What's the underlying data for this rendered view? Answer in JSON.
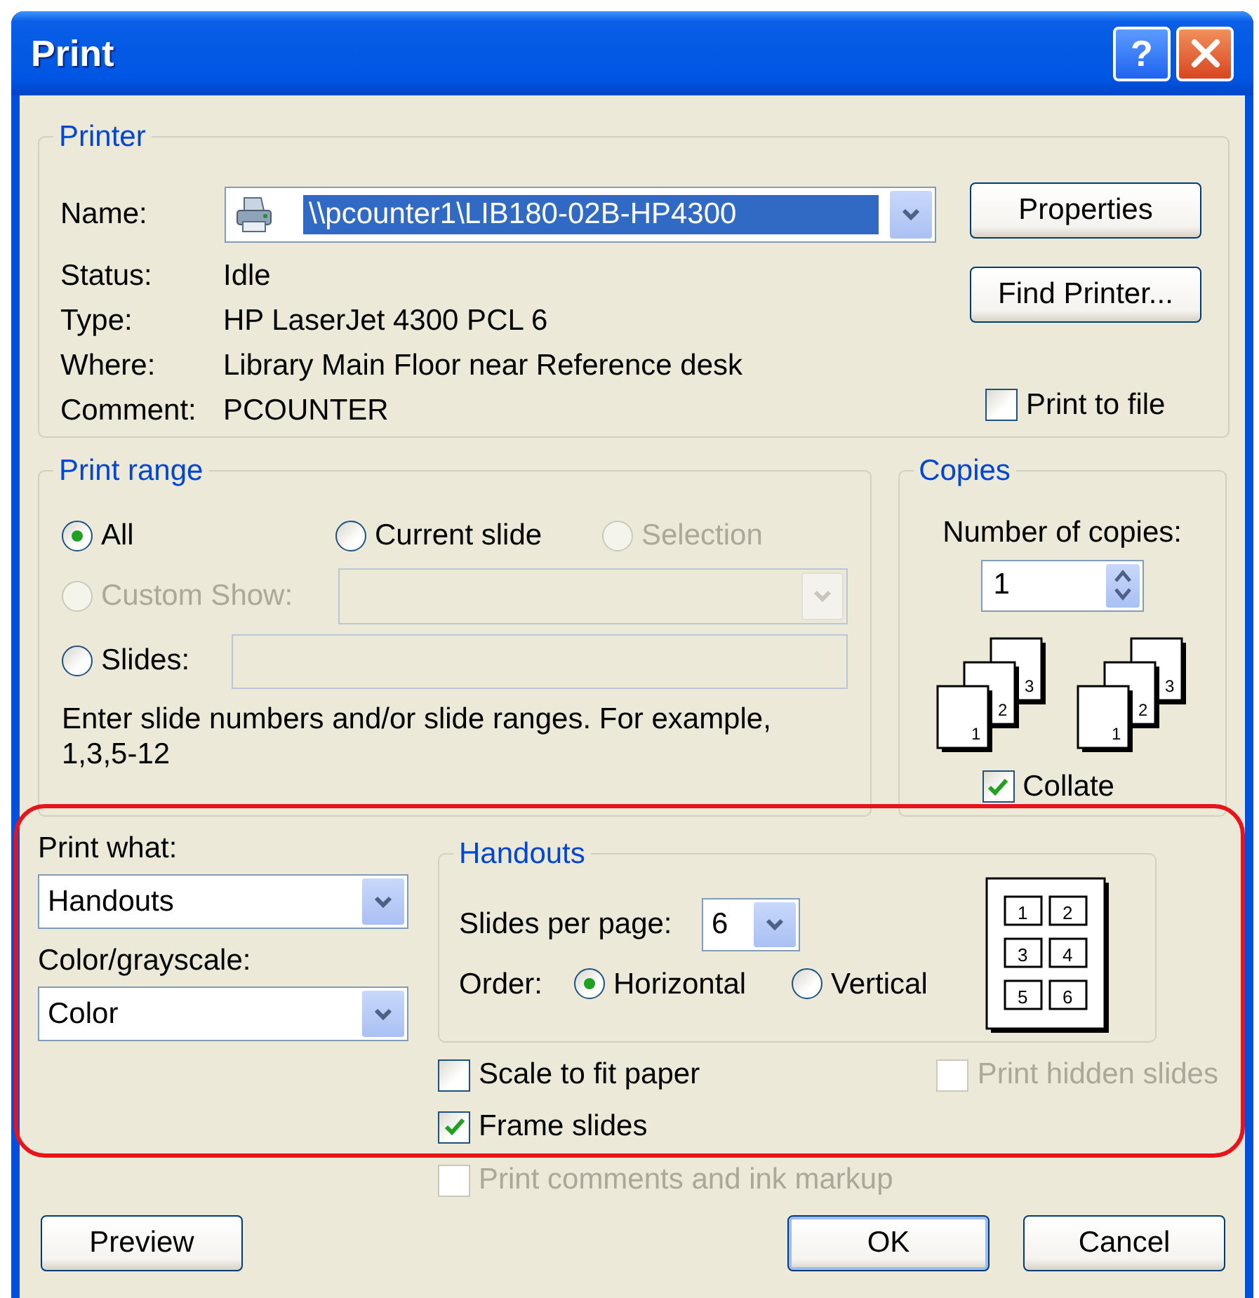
{
  "window": {
    "title": "Print",
    "help_button": "?"
  },
  "printer": {
    "legend": "Printer",
    "name_label": "Name:",
    "name_value": "\\\\pcounter1\\LIB180-02B-HP4300",
    "details": [
      {
        "label": "Status:",
        "value": "Idle"
      },
      {
        "label": "Type:",
        "value": "HP LaserJet 4300 PCL 6"
      },
      {
        "label": "Where:",
        "value": "Library Main Floor near Reference desk"
      },
      {
        "label": "Comment:",
        "value": "PCOUNTER"
      }
    ],
    "buttons": [
      "Properties",
      "Find Printer..."
    ],
    "print_to_file": {
      "label": "Print to file",
      "checked": false
    }
  },
  "print_range": {
    "legend": "Print range",
    "options": [
      {
        "label": "All",
        "selected": true,
        "disabled": false
      },
      {
        "label": "Current slide",
        "selected": false,
        "disabled": false
      },
      {
        "label": "Selection",
        "selected": false,
        "disabled": true
      },
      {
        "label": "Custom Show:",
        "selected": false,
        "disabled": true
      },
      {
        "label": "Slides:",
        "selected": false,
        "disabled": false
      }
    ],
    "hint": "Enter slide numbers and/or slide ranges. For example, 1,3,5-12"
  },
  "copies": {
    "legend": "Copies",
    "label": "Number of copies:",
    "value": "1",
    "stacks": [
      [
        "1",
        "2",
        "3"
      ],
      [
        "1",
        "2",
        "3"
      ]
    ],
    "collate": {
      "label": "Collate",
      "checked": true
    }
  },
  "print_what": {
    "label": "Print what:",
    "value": "Handouts"
  },
  "color_grayscale": {
    "label": "Color/grayscale:",
    "value": "Color"
  },
  "handouts": {
    "legend": "Handouts",
    "slides_per_page_label": "Slides per page:",
    "slides_per_page": "6",
    "order_label": "Order:",
    "orders": [
      {
        "label": "Horizontal",
        "selected": true
      },
      {
        "label": "Vertical",
        "selected": false
      }
    ],
    "preview_pages": [
      "1",
      "2",
      "3",
      "4",
      "5",
      "6"
    ]
  },
  "options": [
    {
      "label": "Scale to fit paper",
      "checked": false,
      "disabled": false
    },
    {
      "label": "Print hidden slides",
      "checked": false,
      "disabled": true
    },
    {
      "label": "Frame slides",
      "checked": true,
      "disabled": false
    },
    {
      "label": "Print comments and ink markup",
      "checked": false,
      "disabled": true
    }
  ],
  "buttons": [
    {
      "label": "Preview",
      "default": false
    },
    {
      "label": "OK",
      "default": true
    },
    {
      "label": "Cancel",
      "default": false
    }
  ]
}
